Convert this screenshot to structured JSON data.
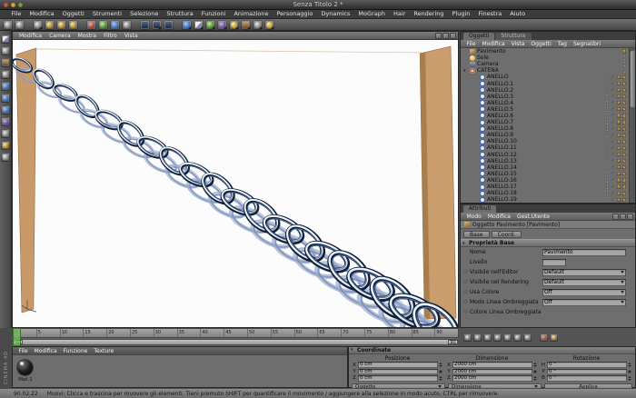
{
  "window": {
    "title": "Senza Titolo 2 *"
  },
  "menubar": {
    "items": [
      "File",
      "Modifica",
      "Oggetti",
      "Strumenti",
      "Selezione",
      "Struttura",
      "Funzioni",
      "Animazione",
      "Personaggio",
      "Dynamics",
      "MoGraph",
      "Hair",
      "Rendering",
      "Plugin",
      "Finestra",
      "Aiuto"
    ]
  },
  "viewport": {
    "menus": [
      "Modifica",
      "Camera",
      "Mostra",
      "Filtro",
      "Vista"
    ]
  },
  "object_manager": {
    "tab_active": "Oggetti",
    "tab_inactive": "Struttura",
    "menus": [
      "File",
      "Modifica",
      "Vista",
      "Oggetti",
      "Tag",
      "Segnalibri"
    ],
    "items": [
      {
        "label": "Pavimento",
        "cls": "ic-floor t1"
      },
      {
        "label": "Sole",
        "cls": "ic-sun t0"
      },
      {
        "label": "Camera",
        "cls": "ic-cam t0"
      },
      {
        "label": "CATENA",
        "cls": "ic-null exp t0"
      },
      {
        "label": "ANELLO",
        "cls": "ic-torus ind t2"
      },
      {
        "label": "ANELLO.1",
        "cls": "ic-torus ind t2"
      },
      {
        "label": "ANELLO.2",
        "cls": "ic-torus ind t2"
      },
      {
        "label": "ANELLO.3",
        "cls": "ic-torus ind t2"
      },
      {
        "label": "ANELLO.4",
        "cls": "ic-torus ind t2"
      },
      {
        "label": "ANELLO.5",
        "cls": "ic-torus ind t2"
      },
      {
        "label": "ANELLO.6",
        "cls": "ic-torus ind t2"
      },
      {
        "label": "ANELLO.7",
        "cls": "ic-torus ind t2"
      },
      {
        "label": "ANELLO.8",
        "cls": "ic-torus ind t2"
      },
      {
        "label": "ANELLO.9",
        "cls": "ic-torus ind t2"
      },
      {
        "label": "ANELLO.10",
        "cls": "ic-torus ind t2"
      },
      {
        "label": "ANELLO.11",
        "cls": "ic-torus ind t2"
      },
      {
        "label": "ANELLO.12",
        "cls": "ic-torus ind t2"
      },
      {
        "label": "ANELLO.13",
        "cls": "ic-torus ind t2"
      },
      {
        "label": "ANELLO.14",
        "cls": "ic-torus ind t2"
      },
      {
        "label": "ANELLO.15",
        "cls": "ic-torus ind t2"
      },
      {
        "label": "ANELLO.16",
        "cls": "ic-torus ind t2"
      },
      {
        "label": "ANELLO.17",
        "cls": "ic-torus ind t2"
      },
      {
        "label": "ANELLO.18",
        "cls": "ic-torus ind t2"
      },
      {
        "label": "ANELLO.19",
        "cls": "ic-torus ind t2"
      }
    ]
  },
  "attribute_manager": {
    "tab": "Attributi",
    "menus": [
      "Modo",
      "Modifica",
      "Gest.Utente"
    ],
    "title": "Oggetto Pavimento [Pavimento]",
    "tab_base": "Base",
    "tab_coord": "Coord.",
    "section": "Proprietà Base",
    "rows": [
      {
        "label": "Nome",
        "value": "Pavimento",
        "cls": "kind-input"
      },
      {
        "label": "Livello",
        "value": "",
        "cls": "kind-layer"
      },
      {
        "label": "Visibile nell'Editor",
        "value": "Default",
        "cls": "kind-drop hasdot"
      },
      {
        "label": "Visibile nel Rendering",
        "value": "Default",
        "cls": "kind-drop hasdot"
      },
      {
        "label": "Usa Colore",
        "value": "Off",
        "cls": "kind-drop hasdot"
      },
      {
        "label": "Modo Linea Ombreggiata",
        "value": "Off",
        "cls": "kind-drop hasdot"
      },
      {
        "label": "Colore Linea Ombreggiata",
        "value": "",
        "cls": "kind-none hasdot"
      }
    ]
  },
  "timeline": {
    "ticks": [
      "0",
      "5",
      "10",
      "15",
      "20",
      "25",
      "30",
      "35",
      "40",
      "45",
      "50",
      "55",
      "60",
      "65",
      "70",
      "75",
      "80",
      "85",
      "90"
    ],
    "range_start": "0",
    "range_end": "90"
  },
  "material_manager": {
    "menus": [
      "File",
      "Modifica",
      "Funzione",
      "Texture"
    ],
    "materials": [
      {
        "name": "Mat.1"
      }
    ]
  },
  "coordinates": {
    "title": "Coordinate",
    "columns": [
      {
        "header": "Posizione",
        "rows": [
          [
            "X",
            "0 cm"
          ],
          [
            "Y",
            "0 cm"
          ],
          [
            "Z",
            "0 cm"
          ]
        ]
      },
      {
        "header": "Dimensione",
        "rows": [
          [
            "X",
            "2000 cm"
          ],
          [
            "Y",
            "2000 cm"
          ],
          [
            "Z",
            "2000 cm"
          ]
        ]
      },
      {
        "header": "Rotazione",
        "rows": [
          [
            "H",
            "0 °"
          ],
          [
            "P",
            "0 °"
          ],
          [
            "B",
            "0 °"
          ]
        ]
      }
    ],
    "buttons": {
      "object": "Oggetto",
      "size": "Dimensione",
      "apply": "Applica"
    }
  },
  "statusbar": {
    "version": "90.02.22",
    "message": "Muovi: Clicca e trascina per muovere gli elementi. Tieni premuto SHIFT per quantificare il movimento / aggiungere alla selezione in modo acuto, CTRL per rimuovere."
  },
  "branding": {
    "vertical": "CINEMA 4D"
  }
}
